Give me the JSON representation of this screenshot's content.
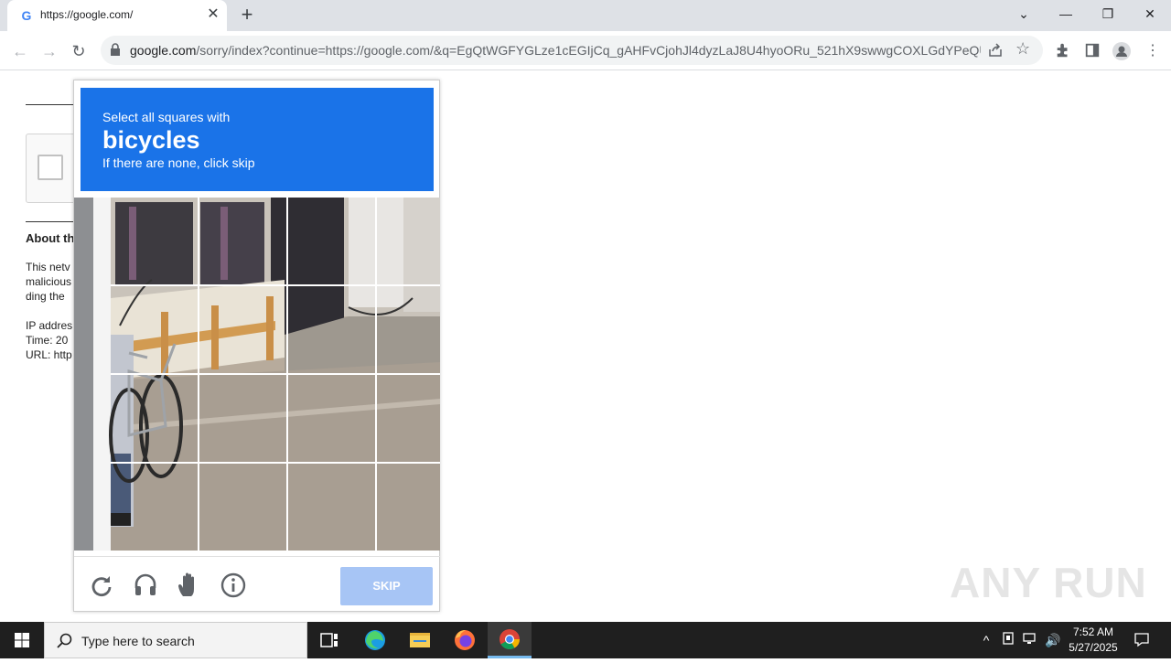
{
  "browser": {
    "tab_title": "https://google.com/",
    "tab_favicon": "G",
    "url_host": "google.com",
    "url_path": "/sorry/index?continue=https://google.com/&q=EgQtWGFYGLze1cEGIjCq_gAHFvCjohJl4dyzLaJ8U4hyoORu_521hX9swwgCOXLGdYPeQUo..."
  },
  "page": {
    "about_heading": "About th",
    "line1": "This netv",
    "line2": "malicious",
    "line3": "ding the",
    "ip": "IP addres",
    "time": "Time: 20",
    "url": "URL: http"
  },
  "captcha": {
    "prompt_line1": "Select all squares with",
    "target": "bicycles",
    "prompt_line3": "If there are none, click skip",
    "skip_label": "SKIP",
    "grid_size": 4,
    "header_color": "#1a73e8",
    "footer_icons": [
      "reload-icon",
      "audio-icon",
      "hand-icon",
      "info-icon"
    ]
  },
  "watermark": "ANY RUN",
  "taskbar": {
    "search_placeholder": "Type here to search",
    "time": "7:52 AM",
    "date": "5/27/2025"
  }
}
